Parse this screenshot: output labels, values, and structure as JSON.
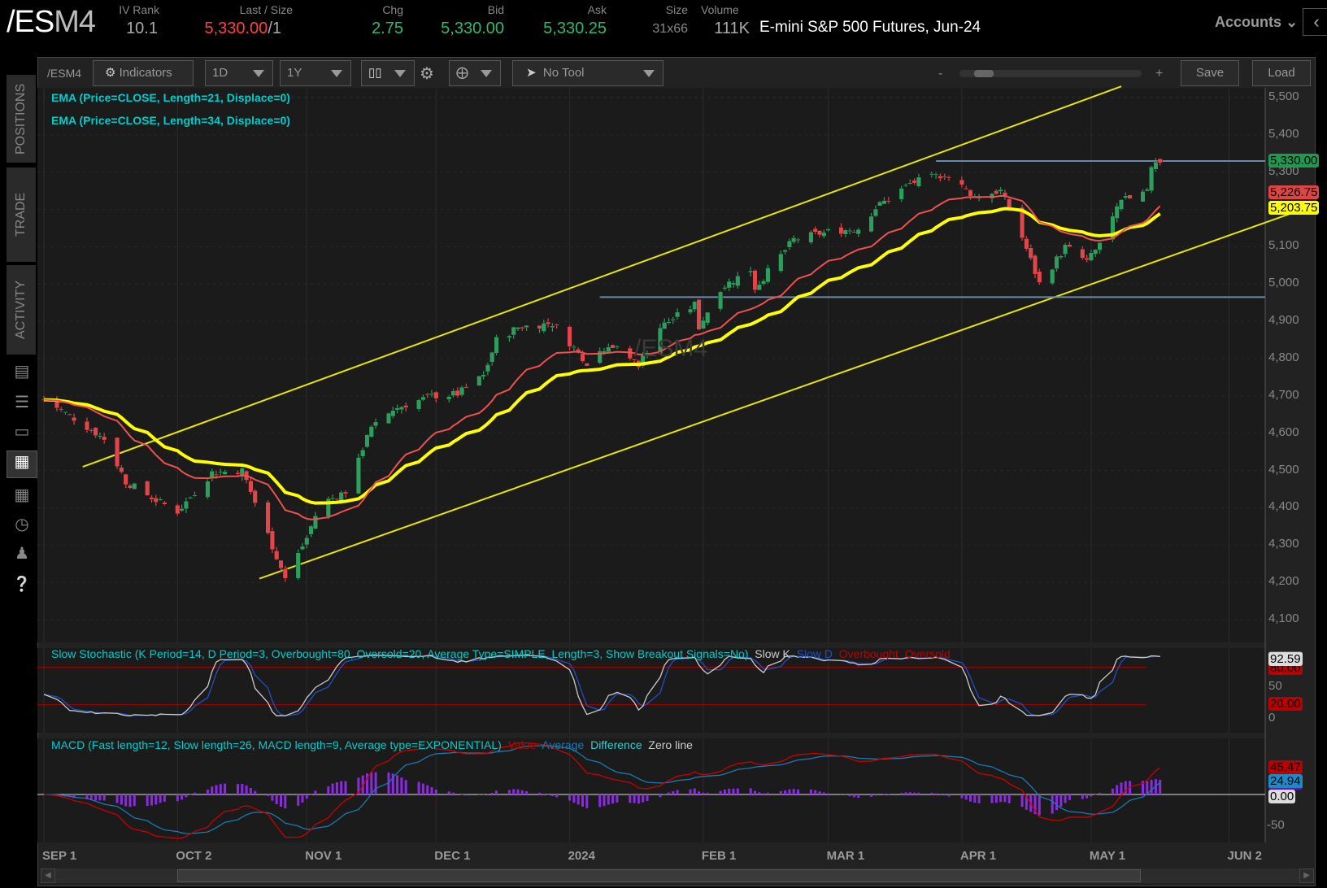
{
  "header": {
    "symbol_prefix": "/ES",
    "symbol_suffix": "M4",
    "iv_rank_label": "IV Rank",
    "iv_rank": "10.1",
    "last_size_label": "Last / Size",
    "last": "5,330.00",
    "last_size": "/1",
    "chg_label": "Chg",
    "chg": "2.75",
    "bid_label": "Bid",
    "bid": "5,330.00",
    "ask_label": "Ask",
    "ask": "5,330.25",
    "size_label": "Size",
    "size": "31x66",
    "volume_label": "Volume",
    "volume": "111K",
    "description": "E-mini S&P 500 Futures, Jun-24",
    "accounts": "Accounts"
  },
  "sidebar": {
    "tabs": [
      "POSITIONS",
      "TRADE",
      "ACTIVITY"
    ]
  },
  "toolbar": {
    "symbol": "/ESM4",
    "indicators": "Indicators",
    "aggregation": "1D",
    "range": "1Y",
    "tool": "No Tool",
    "zoom_minus": "-",
    "zoom_plus": "+",
    "save": "Save",
    "load": "Load"
  },
  "studies": {
    "ema21": "EMA (Price=CLOSE, Length=21, Displace=0)",
    "ema34": "EMA (Price=CLOSE, Length=34, Displace=0)",
    "stoch": "Slow Stochastic (K Period=14, D Period=3, Overbought=80, Oversold=20, Average Type=SIMPLE, Length=3, Show Breakout Signals=No)",
    "stoch_legend": [
      "Slow K",
      "Slow D",
      "Overbought",
      "Oversold"
    ],
    "macd": "MACD (Fast length=12, Slow length=26, MACD length=9, Average type=EXPONENTIAL)",
    "macd_legend": [
      "Value",
      "Average",
      "Difference",
      "Zero line"
    ]
  },
  "watermark": "/ESM4",
  "badges": {
    "last": "5,330.00",
    "ema21": "5,226.75",
    "ema34": "5,203.75",
    "slow_k": "92.59",
    "overbought": "80.00",
    "oversold": "20.00",
    "macd_value": "45.47",
    "macd_avg": "24.94",
    "macd_diff": "0.00"
  },
  "colors": {
    "up": "#2e9e5e",
    "down": "#e0474c",
    "ema21": "#f05050",
    "ema34": "#ffff00",
    "channel": "#e6e600",
    "level": "#6a8aa8"
  },
  "chart_data": {
    "type": "candlestick",
    "price_axis": {
      "ticks": [
        "5,500",
        "5,400",
        "5,300",
        "5,200",
        "5,100",
        "5,000",
        "4,900",
        "4,800",
        "4,700",
        "4,600",
        "4,500",
        "4,400",
        "4,300",
        "4,200",
        "4,100"
      ],
      "range": [
        4050,
        5520
      ]
    },
    "x_axis": {
      "labels": [
        "SEP 1",
        "OCT 2",
        "NOV 1",
        "DEC 1",
        "2024",
        "FEB 1",
        "MAR 1",
        "APR 1",
        "MAY 1",
        "JUN 2"
      ],
      "label_days": [
        0,
        31,
        61,
        91,
        122,
        153,
        182,
        213,
        243,
        275
      ]
    },
    "close_path": [
      [
        0,
        4690
      ],
      [
        7,
        4640
      ],
      [
        14,
        4585
      ],
      [
        19,
        4470
      ],
      [
        26,
        4420
      ],
      [
        31,
        4390
      ],
      [
        39,
        4495
      ],
      [
        46,
        4500
      ],
      [
        50,
        4385
      ],
      [
        56,
        4210
      ],
      [
        61,
        4320
      ],
      [
        64,
        4410
      ],
      [
        71,
        4450
      ],
      [
        75,
        4600
      ],
      [
        81,
        4665
      ],
      [
        90,
        4700
      ],
      [
        96,
        4705
      ],
      [
        102,
        4755
      ],
      [
        105,
        4850
      ],
      [
        110,
        4885
      ],
      [
        118,
        4895
      ],
      [
        126,
        4790
      ],
      [
        131,
        4840
      ],
      [
        138,
        4785
      ],
      [
        143,
        4885
      ],
      [
        151,
        4945
      ],
      [
        152,
        4885
      ],
      [
        157,
        4990
      ],
      [
        164,
        5040
      ],
      [
        165,
        4990
      ],
      [
        174,
        5120
      ],
      [
        182,
        5140
      ],
      [
        189,
        5150
      ],
      [
        193,
        5205
      ],
      [
        201,
        5270
      ],
      [
        209,
        5295
      ],
      [
        216,
        5235
      ],
      [
        222,
        5250
      ],
      [
        227,
        5125
      ],
      [
        231,
        5000
      ],
      [
        237,
        5100
      ],
      [
        242,
        5060
      ],
      [
        244,
        5090
      ],
      [
        250,
        5220
      ],
      [
        256,
        5260
      ],
      [
        257,
        5320
      ],
      [
        259,
        5330
      ]
    ],
    "levels": [
      5330,
      4965
    ],
    "channel": {
      "upper": [
        [
          9,
          4510
        ],
        [
          250,
          5530
        ]
      ],
      "lower": [
        [
          50,
          4210
        ],
        [
          292,
          5200
        ]
      ]
    },
    "stoch_axis": [
      "50",
      "0"
    ],
    "macd_axis": [
      "-50"
    ]
  }
}
